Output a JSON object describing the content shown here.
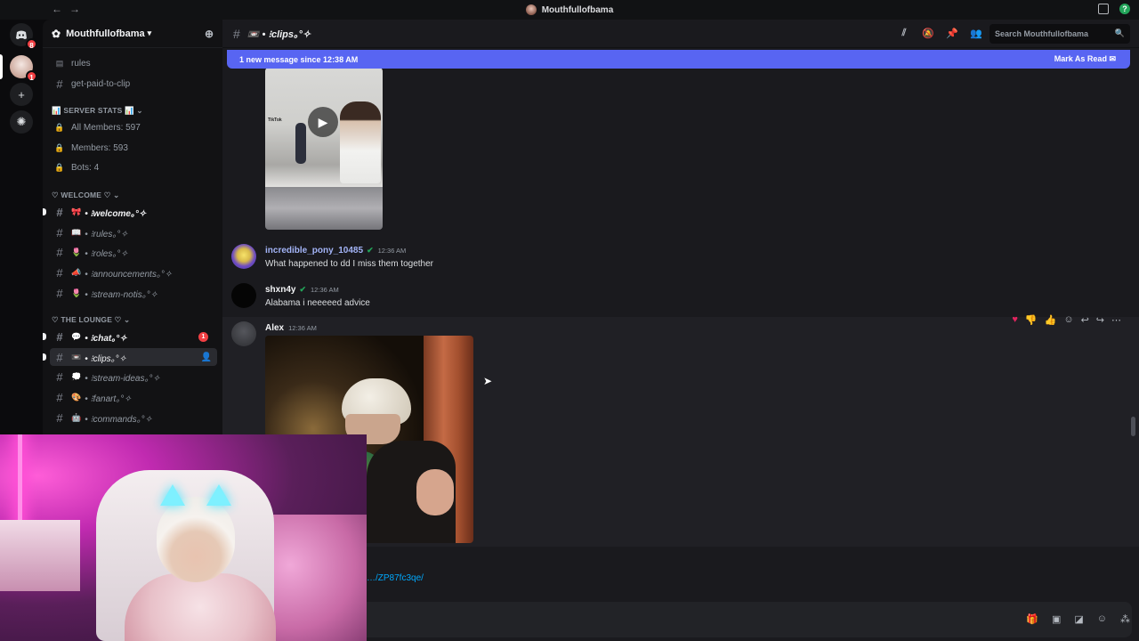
{
  "window": {
    "title": "Mouthfullofbama"
  },
  "server": {
    "name": "Mouthfullofbama"
  },
  "rail": {
    "dm_badge": "8",
    "server_badge": "1"
  },
  "sidebar": {
    "top_channels": [
      {
        "label": "rules"
      },
      {
        "label": "get-paid-to-clip"
      }
    ],
    "categories": {
      "stats": "📊 SERVER STATS 📊",
      "welcome": "♡ WELCOME ♡",
      "lounge": "♡ THE LOUNGE ♡"
    },
    "stats": [
      {
        "label": "All Members: 597"
      },
      {
        "label": "Members: 593"
      },
      {
        "label": "Bots: 4"
      }
    ],
    "welcome_channels": [
      {
        "emoji": "🎀",
        "label": "• ⁝welcome｡°✧"
      },
      {
        "emoji": "📖",
        "label": "• ⁝rules｡°✧"
      },
      {
        "emoji": "🌷",
        "label": "• ⁝roles｡°✧"
      },
      {
        "emoji": "📣",
        "label": "• ⁝announcements｡°✧"
      },
      {
        "emoji": "🌷",
        "label": "• ⁝stream-notis｡°✧"
      }
    ],
    "lounge_channels": [
      {
        "emoji": "💬",
        "label": "• ⁝chat｡°✧",
        "badge": "1"
      },
      {
        "emoji": "📼",
        "label": "• ⁝clips｡°✧"
      },
      {
        "emoji": "💭",
        "label": "• ⁝stream-ideas｡°✧"
      },
      {
        "emoji": "🎨",
        "label": "• ⁝fanart｡°✧"
      },
      {
        "emoji": "🤖",
        "label": "• ⁝commands｡°✧"
      }
    ]
  },
  "topbar": {
    "channel": "📼 • ⁝clips｡°✧",
    "search_placeholder": "Search Mouthfullofbama"
  },
  "main": {
    "new_message_bar": "1 new message since 12:38 AM",
    "mark_as_read": "Mark As Read",
    "messages": [
      {
        "user": "incredible_pony_10485",
        "time": "12:36 AM",
        "text": "What happened to dd I miss them together",
        "name_color": "#a3b4f7"
      },
      {
        "user": "shxn4y",
        "time": "12:36 AM",
        "text": "Alabama i neeeeed advice",
        "name_color": "#f2f3f5"
      },
      {
        "user": "Alex",
        "time": "12:36 AM",
        "text": "",
        "name_color": "#f2f3f5"
      }
    ],
    "partial_link": "…/ZP87fc3qe/"
  },
  "colors": {
    "blurple": "#5865f2",
    "link": "#00a8fc",
    "online": "#23a55a",
    "mention": "#f23f43"
  }
}
